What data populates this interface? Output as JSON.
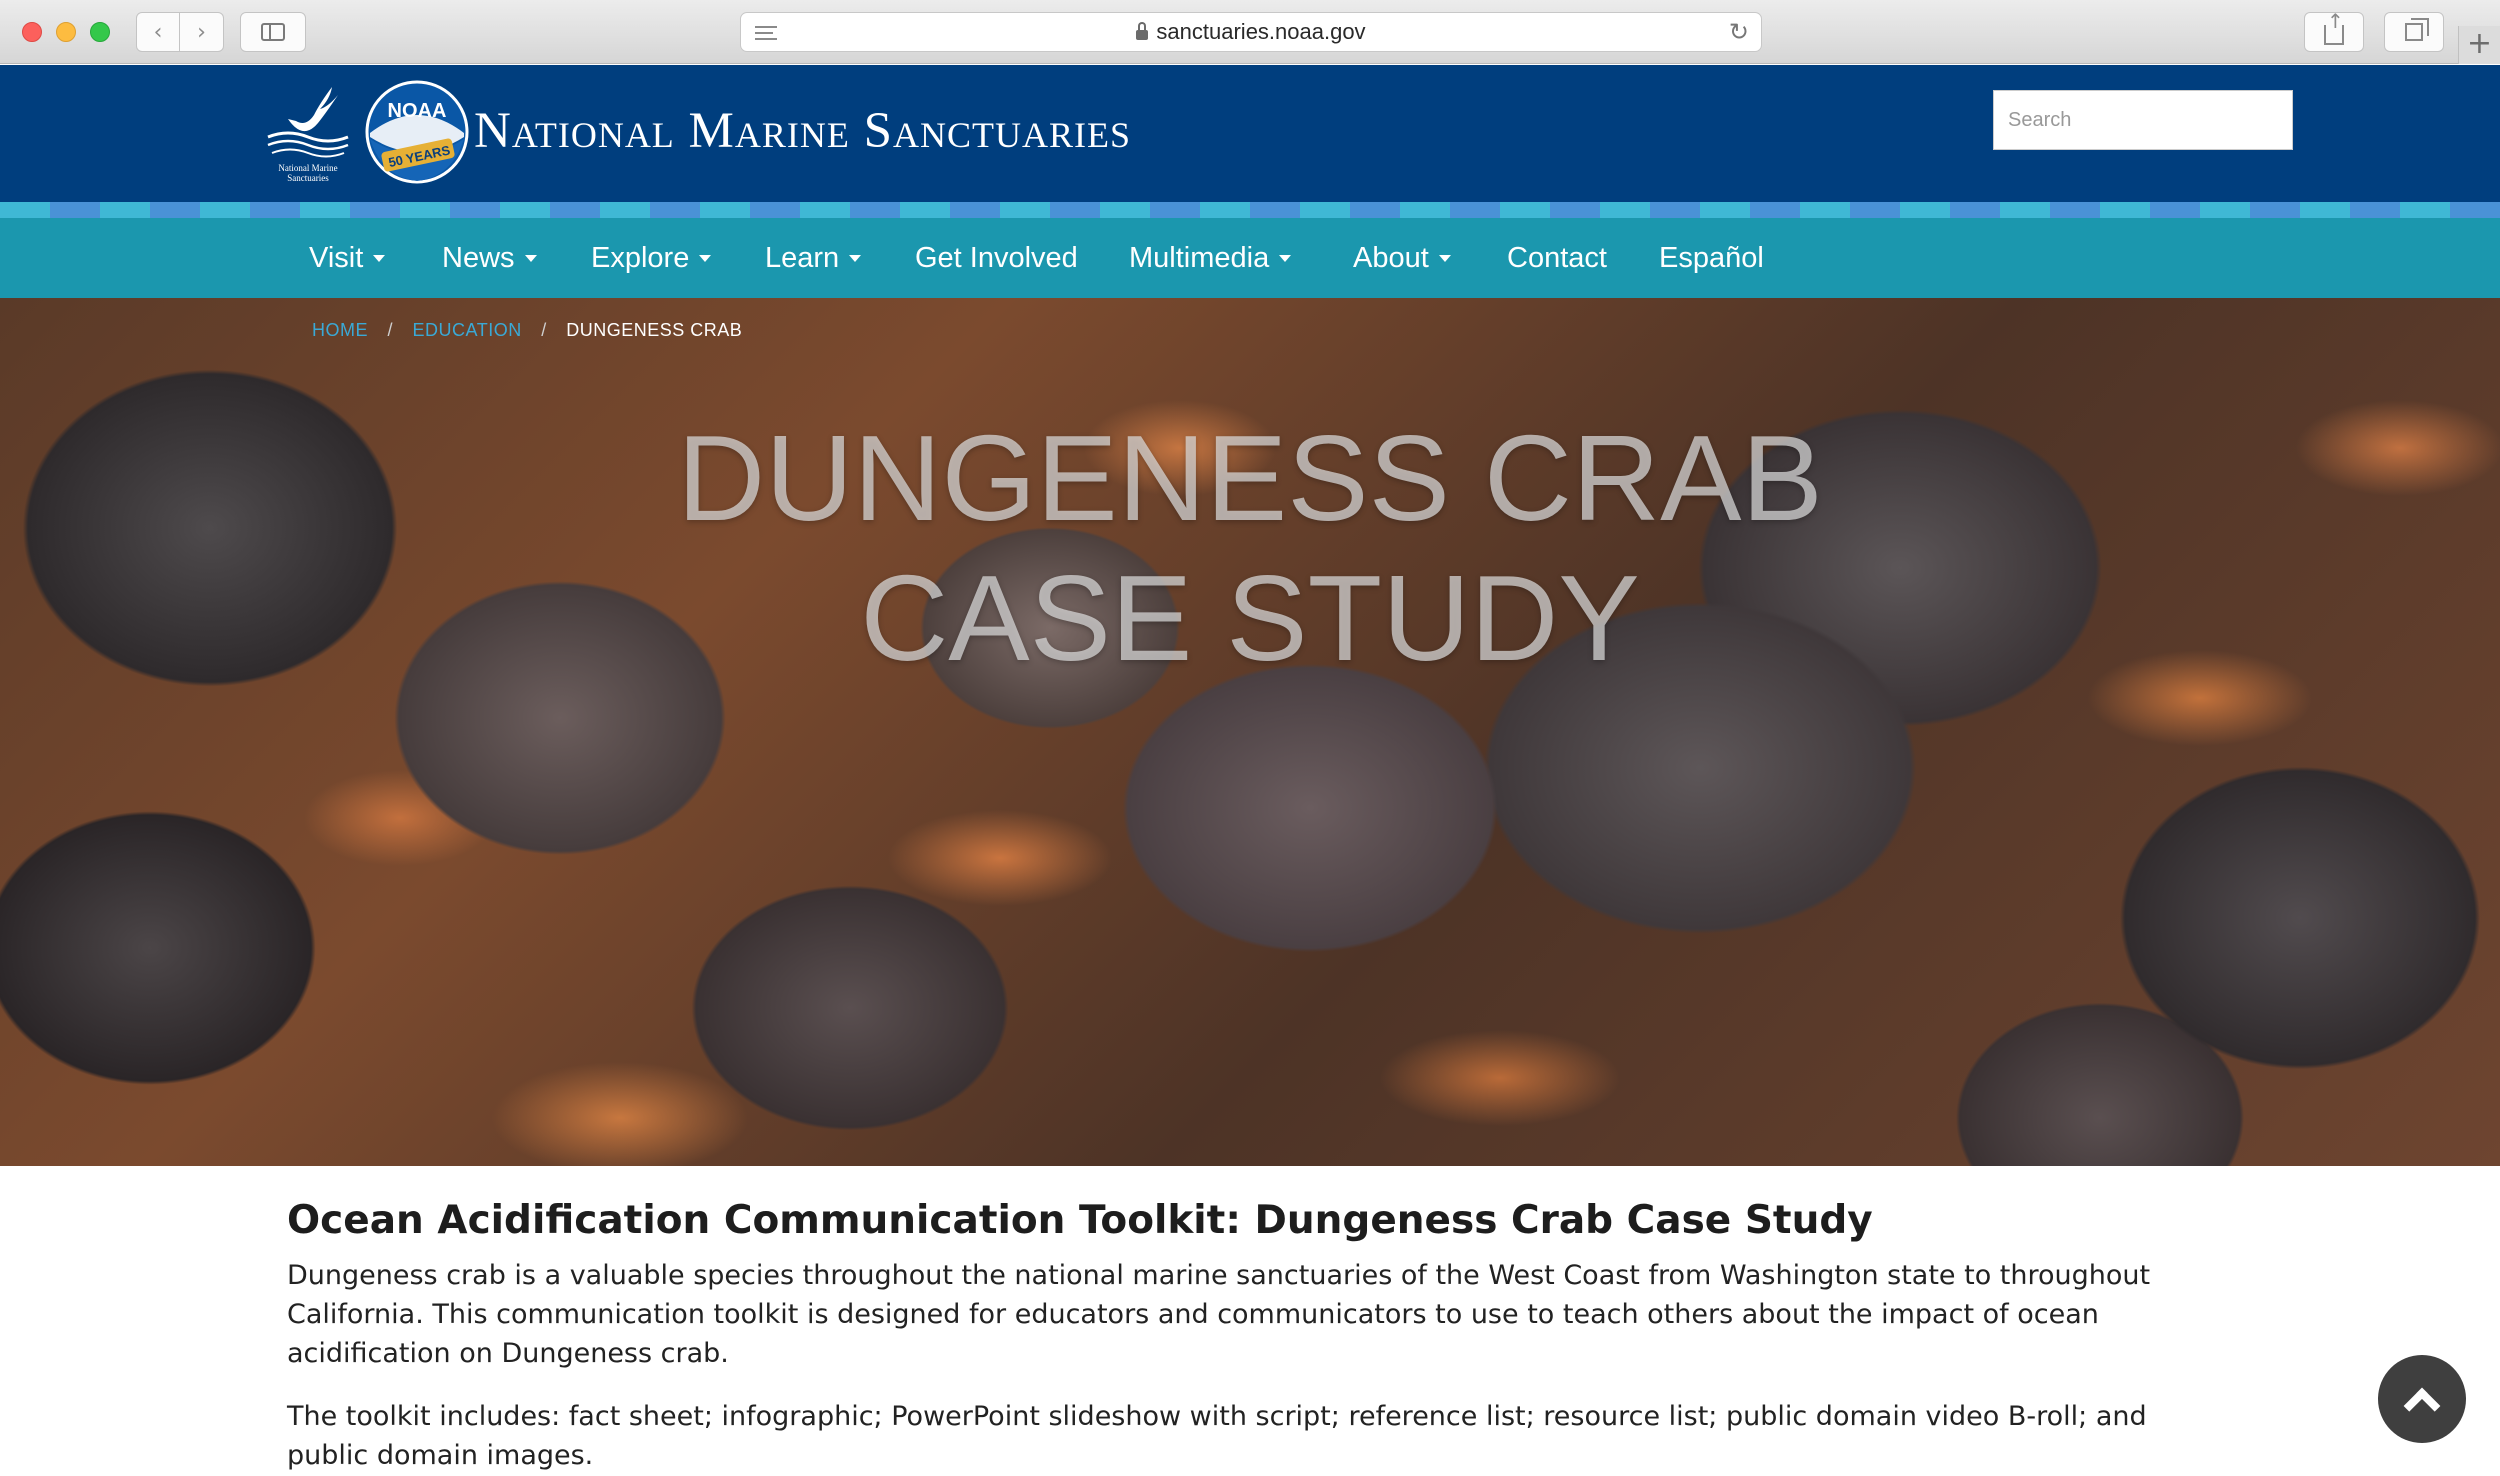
{
  "browser": {
    "url": "sanctuaries.noaa.gov",
    "new_tab_symbol": "+"
  },
  "header": {
    "site_title": "National Marine Sanctuaries",
    "whale_logo_text": [
      "National Marine",
      "Sanctuaries"
    ],
    "noaa_logo_text": "NOAA",
    "anniversary_text": "50 YEARS",
    "search_placeholder": "Search",
    "colors": {
      "header_bg": "#003e7e",
      "nav_bg": "#1b97ae"
    }
  },
  "nav": {
    "items": [
      {
        "label": "Visit",
        "dropdown": true
      },
      {
        "label": "News",
        "dropdown": true
      },
      {
        "label": "Explore",
        "dropdown": true
      },
      {
        "label": "Learn",
        "dropdown": true
      },
      {
        "label": "Get Involved",
        "dropdown": false
      },
      {
        "label": "Multimedia",
        "dropdown": true
      },
      {
        "label": "About",
        "dropdown": true
      },
      {
        "label": "Contact",
        "dropdown": false
      },
      {
        "label": "Español",
        "dropdown": false
      }
    ]
  },
  "breadcrumb": {
    "home": "Home",
    "education": "Education",
    "current": "Dungeness Crab",
    "separator": "/"
  },
  "hero": {
    "title_line1": "Dungeness Crab",
    "title_line2": "Case Study"
  },
  "content": {
    "heading": "Ocean Acidification Communication Toolkit: Dungeness Crab Case Study",
    "paragraph1": "Dungeness crab is a valuable species throughout the national marine sanctuaries of the West Coast from Washington state to throughout California. This communication toolkit is designed for educators and communicators to use to teach others about the impact of ocean acidification on Dungeness crab.",
    "paragraph2": "The toolkit includes: fact sheet; infographic; PowerPoint slideshow with script; reference list; resource list; public domain video B-roll; and public domain images."
  }
}
